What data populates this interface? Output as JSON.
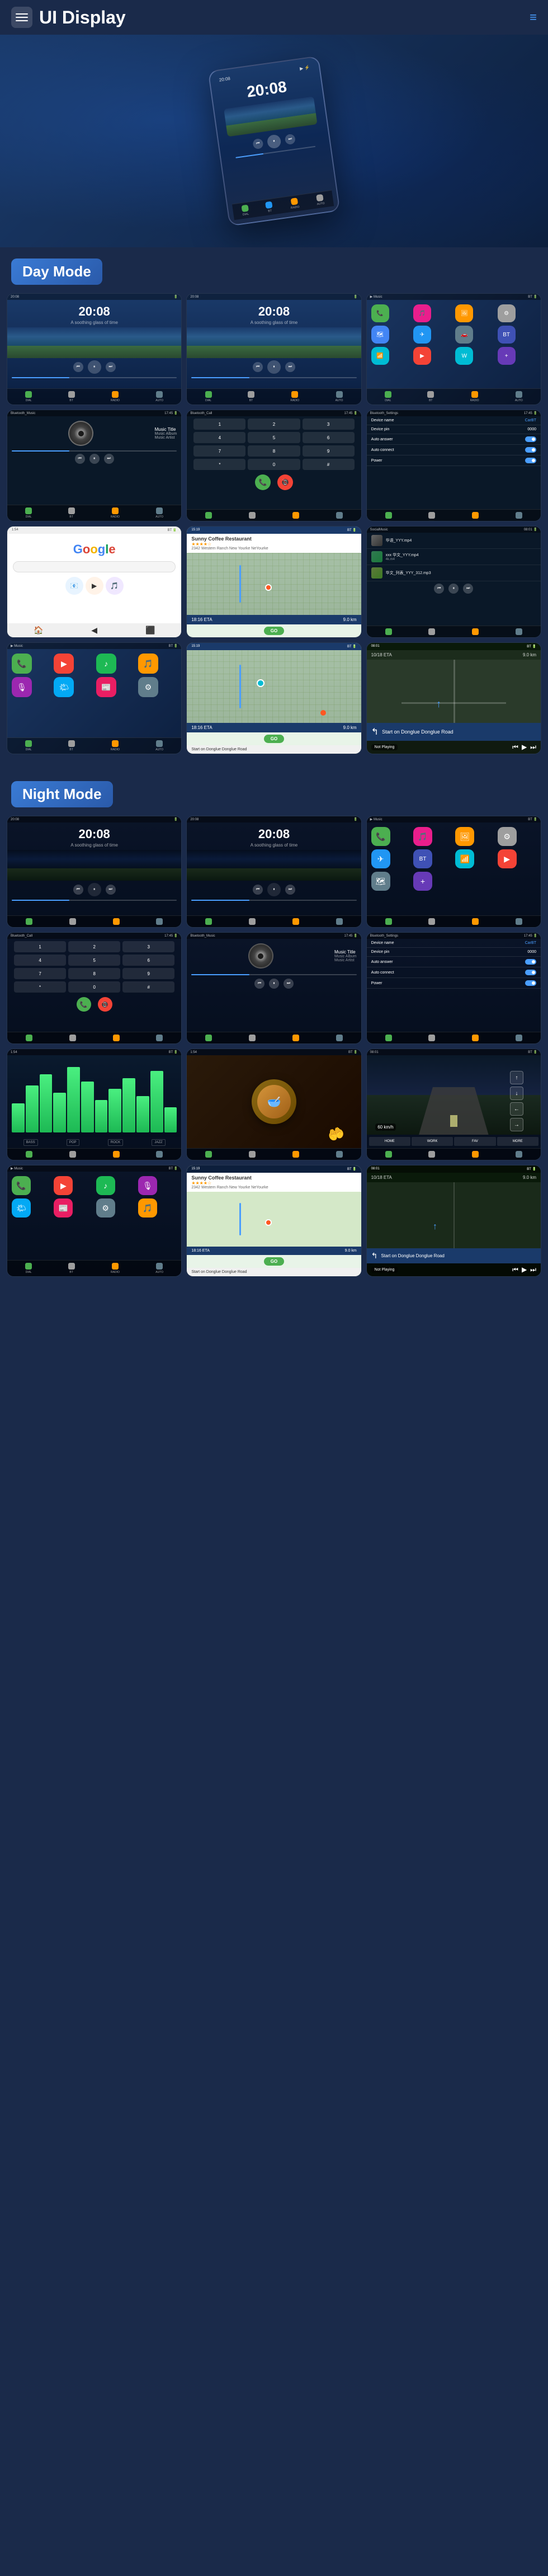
{
  "header": {
    "title": "UI Display",
    "menu_label": "menu",
    "nav_icon": "≡"
  },
  "sections": {
    "day_mode": {
      "label": "Day Mode"
    },
    "night_mode": {
      "label": "Night Mode"
    }
  },
  "screens": {
    "time": "20:08",
    "music_title": "Music Title",
    "music_album": "Music Album",
    "music_artist": "Music Artist",
    "bluetooth_music": "Bluetooth_Music",
    "bluetooth_call": "Bluetooth_Call",
    "bluetooth_settings": "Bluetooth_Settings",
    "device_name_label": "Device name",
    "device_name_value": "CarBT",
    "device_pin_label": "Device pin",
    "device_pin_value": "0000",
    "auto_answer_label": "Auto answer",
    "auto_connect_label": "Auto connect",
    "power_label": "Power",
    "google": "Google",
    "social_music": "SocialMusic",
    "sunny_coffee": "Sunny Coffee Restaurant",
    "sunny_coffee_address": "2342 Western Ranch New Yourke NeYourke",
    "eta_label": "18:16 ETA",
    "distance_label": "9.0 km",
    "go_label": "GO",
    "start_label": "Start on Donglue Donglue Road",
    "not_playing": "Not Playing",
    "dial_buttons": [
      "1",
      "2",
      "3",
      "4",
      "5",
      "6",
      "7",
      "8",
      "9",
      "*",
      "0",
      "#"
    ]
  },
  "icons": {
    "colors": {
      "phone": "#4CAF50",
      "music": "#e91e8c",
      "maps": "#4285F4",
      "settings": "#9E9E9E",
      "bt": "#2196F3",
      "radio": "#FF9800",
      "video": "#F44336",
      "accent": "#3a7bd5"
    }
  }
}
